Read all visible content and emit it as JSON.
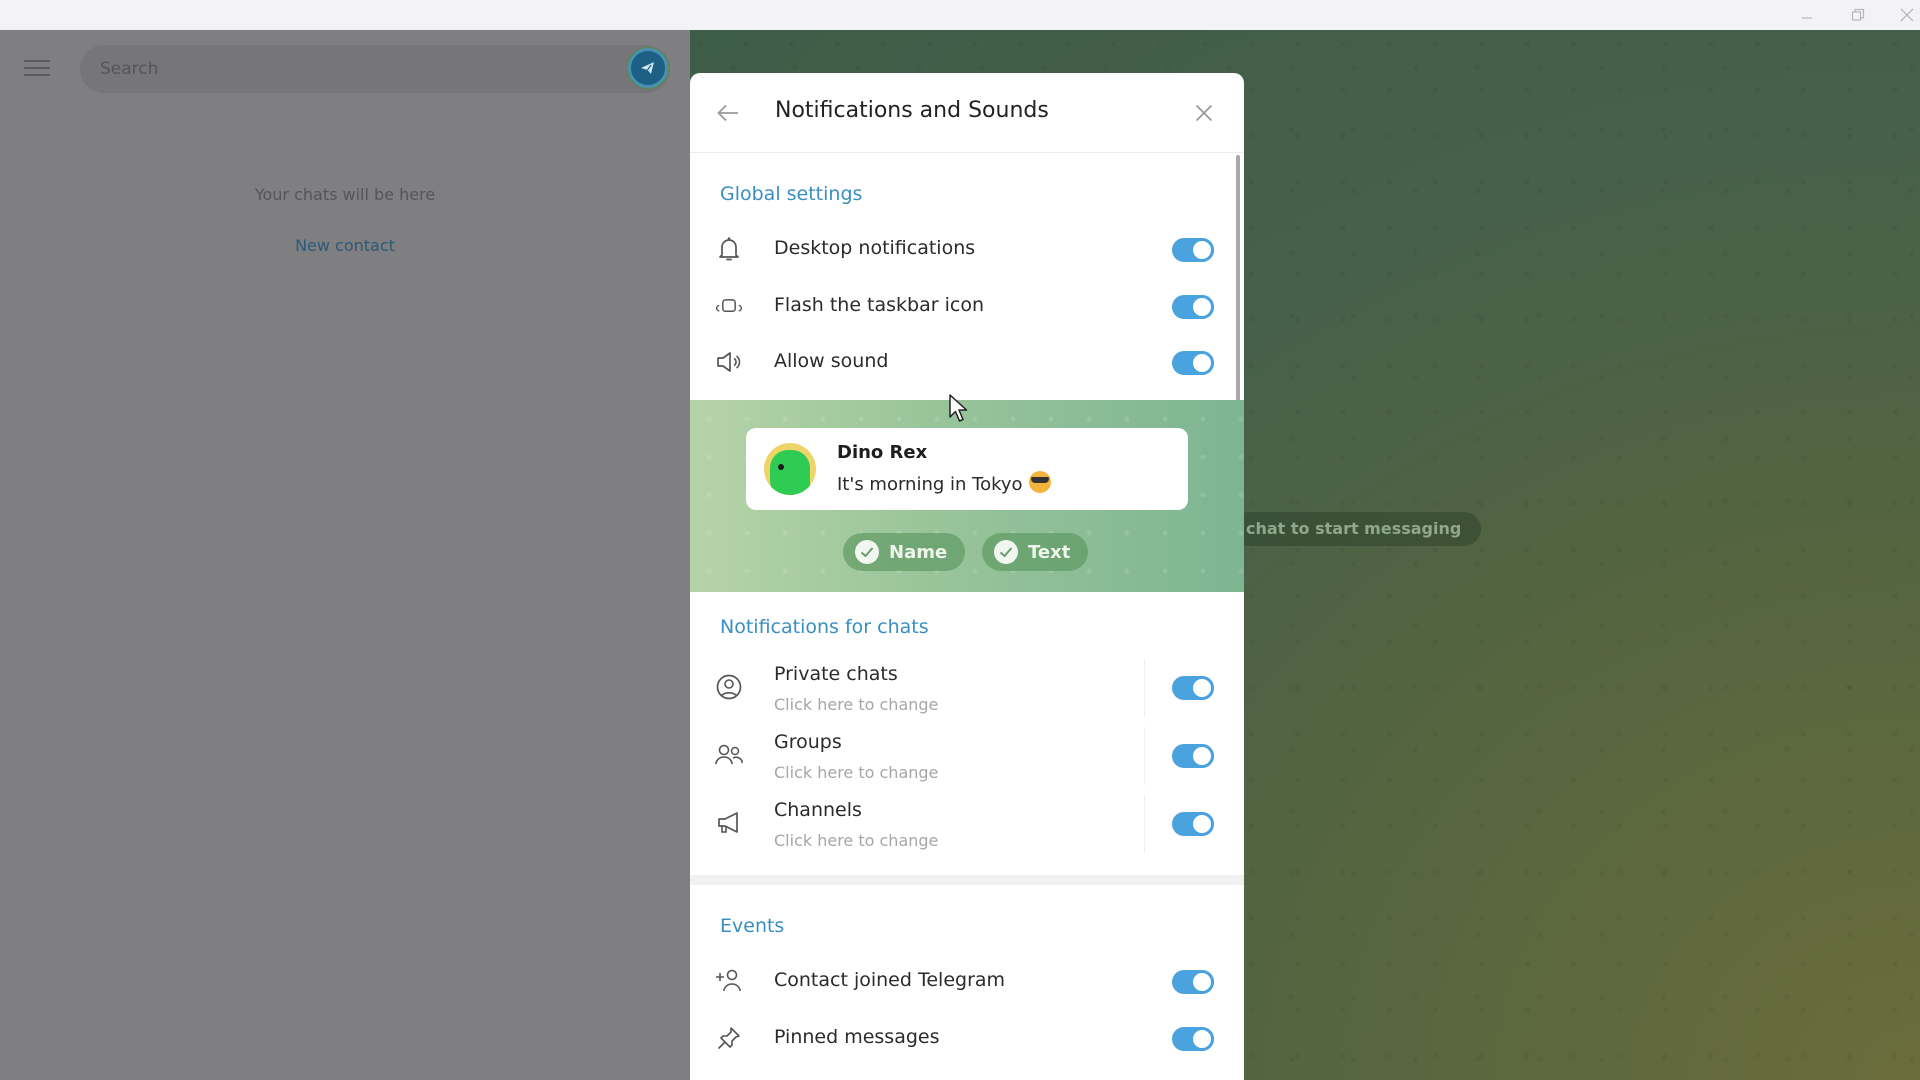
{
  "window": {
    "controls": [
      "minimize",
      "restore",
      "close"
    ]
  },
  "left_panel": {
    "menu_icon": "hamburger-icon",
    "search_placeholder": "Search",
    "empty_text": "Your chats will be here",
    "new_contact_label": "New contact"
  },
  "chat_area": {
    "hint": "chat to start messaging"
  },
  "dialog": {
    "title": "Notifications and Sounds",
    "global": {
      "title": "Global settings",
      "items": [
        {
          "label": "Desktop notifications",
          "icon": "bell-icon",
          "enabled": true
        },
        {
          "label": "Flash the taskbar icon",
          "icon": "taskbar-flash-icon",
          "enabled": true
        },
        {
          "label": "Allow sound",
          "icon": "speaker-icon",
          "enabled": true
        }
      ]
    },
    "preview": {
      "name": "Dino Rex",
      "text": "It's morning in Tokyo",
      "emoji": "sunglasses-emoji",
      "chips": [
        {
          "label": "Name",
          "checked": true
        },
        {
          "label": "Text",
          "checked": true
        }
      ]
    },
    "chats": {
      "title": "Notifications for chats",
      "items": [
        {
          "label": "Private chats",
          "sub": "Click here to change",
          "icon": "user-circle-icon",
          "enabled": true
        },
        {
          "label": "Groups",
          "sub": "Click here to change",
          "icon": "group-icon",
          "enabled": true
        },
        {
          "label": "Channels",
          "sub": "Click here to change",
          "icon": "megaphone-icon",
          "enabled": true
        }
      ]
    },
    "events": {
      "title": "Events",
      "items": [
        {
          "label": "Contact joined Telegram",
          "icon": "add-user-icon",
          "enabled": true
        },
        {
          "label": "Pinned messages",
          "icon": "pin-icon",
          "enabled": true
        }
      ]
    }
  },
  "colors": {
    "accent": "#4aa3df",
    "section_title": "#3a8fc2",
    "link": "#2b5a78"
  }
}
